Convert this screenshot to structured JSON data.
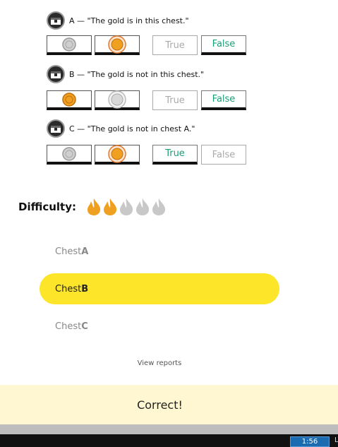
{
  "statements": [
    {
      "label": "A — \"The gold is in this chest.\"",
      "true_label": "True",
      "false_label": "False",
      "selected_coin": "b",
      "selected_answer": "false"
    },
    {
      "label": "B — \"The gold is not in this chest.\"",
      "true_label": "True",
      "false_label": "False",
      "selected_coin": "a",
      "selected_answer": "false"
    },
    {
      "label": "C — \"The gold is not in chest A.\"",
      "true_label": "True",
      "false_label": "False",
      "selected_coin": "b",
      "selected_answer": "true"
    }
  ],
  "difficulty": {
    "label": "Difficulty:",
    "level": 2,
    "max": 5
  },
  "answers": [
    {
      "prefix": "Chest ",
      "letter": "A",
      "selected": false
    },
    {
      "prefix": "Chest ",
      "letter": "B",
      "selected": true
    },
    {
      "prefix": "Chest ",
      "letter": "C",
      "selected": false
    }
  ],
  "view_reports": "View reports",
  "result": "Correct!",
  "taskbar": {
    "clock": "1:56",
    "edge_text": "L"
  },
  "colors": {
    "highlight": "#fde52a",
    "correct_text": "#1a9e78",
    "coin_gold": "#f0a020",
    "flame_active": "#f0a020",
    "flame_inactive": "#c8c8c8"
  }
}
